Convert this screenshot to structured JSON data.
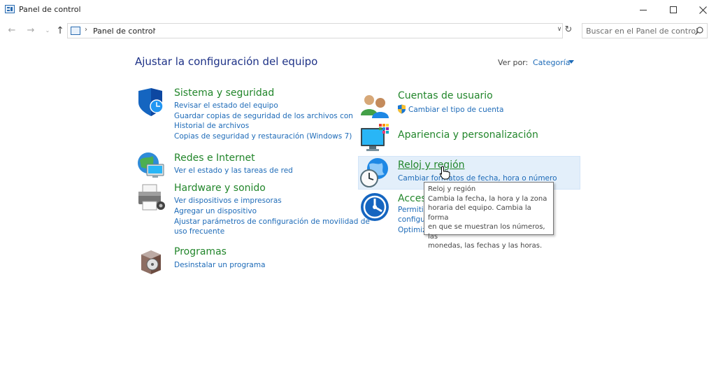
{
  "window": {
    "title": "Panel de control"
  },
  "address": {
    "crumb": "Panel de control",
    "search_placeholder": "Buscar en el Panel de control"
  },
  "main": {
    "title": "Ajustar la configuración del equipo",
    "view_by_label": "Ver por:",
    "view_by_value": "Categoría"
  },
  "categories": {
    "system": {
      "title": "Sistema y seguridad",
      "links": [
        "Revisar el estado del equipo",
        "Guardar copias de seguridad de los archivos con",
        "Historial de archivos",
        "Copias de seguridad y restauración (Windows 7)"
      ]
    },
    "network": {
      "title": "Redes e Internet",
      "links": [
        "Ver el estado y las tareas de red"
      ]
    },
    "hardware": {
      "title": "Hardware y sonido",
      "links": [
        "Ver dispositivos e impresoras",
        "Agregar un dispositivo",
        "Ajustar parámetros de configuración de movilidad de",
        "uso frecuente"
      ]
    },
    "programs": {
      "title": "Programas",
      "links": [
        "Desinstalar un programa"
      ]
    },
    "users": {
      "title": "Cuentas de usuario",
      "links": [
        "Cambiar el tipo de cuenta"
      ]
    },
    "appearance": {
      "title": "Apariencia y personalización",
      "links": []
    },
    "clock": {
      "title": "Reloj y región",
      "links": [
        "Cambiar formatos de fecha, hora o número"
      ]
    },
    "access": {
      "title": "Acces",
      "links": [
        "Permiti",
        "configu",
        "Optimiz"
      ]
    }
  },
  "tooltip": {
    "title": "Reloj y región",
    "lines": [
      "Cambia la fecha, la hora y la zona",
      "horaria del equipo. Cambia la forma",
      "en que se muestran los números, las",
      "monedas, las fechas y las horas."
    ]
  },
  "colors": {
    "title_blue": "#1e3287",
    "link_blue": "#1e6bb8",
    "category_green": "#22862b",
    "hover_bg": "#e3effa"
  }
}
